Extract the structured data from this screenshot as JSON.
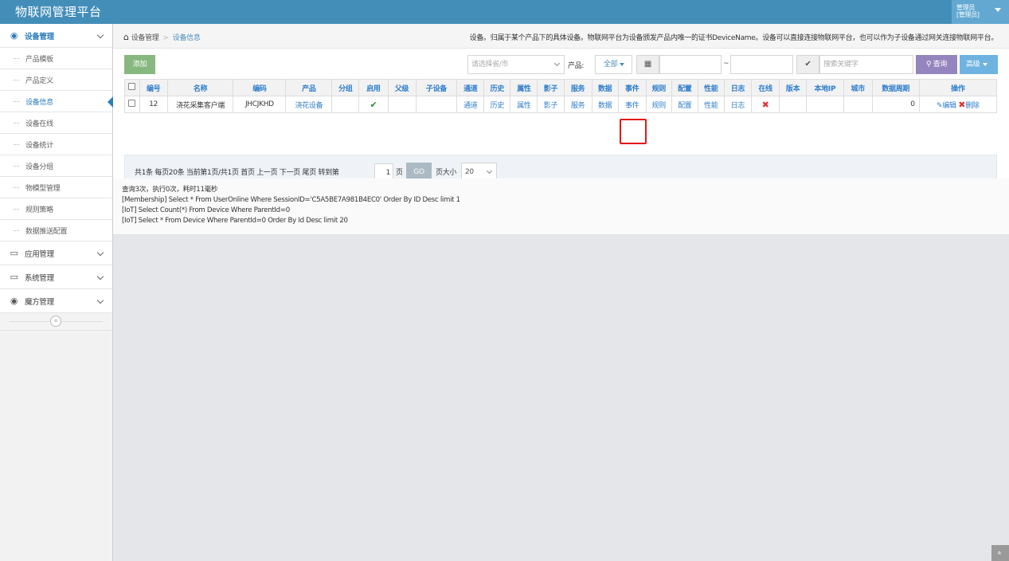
{
  "header": {
    "brand": "物联网管理平台",
    "user_menu": "管理员\n[管理员]"
  },
  "sidebar": {
    "groups": [
      {
        "label": "设备管理",
        "icon": "tachometer-icon",
        "active": true
      },
      {
        "label": "应用管理",
        "icon": "desktop-icon"
      },
      {
        "label": "系统管理",
        "icon": "desktop-icon"
      },
      {
        "label": "魔方管理",
        "icon": "tachometer-icon"
      }
    ],
    "items": [
      {
        "label": "产品模板"
      },
      {
        "label": "产品定义"
      },
      {
        "label": "设备信息",
        "active": true
      },
      {
        "label": "设备在线"
      },
      {
        "label": "设备统计"
      },
      {
        "label": "设备分组"
      },
      {
        "label": "物模型管理"
      },
      {
        "label": "规则策略"
      },
      {
        "label": "数据推送配置"
      }
    ],
    "collapse_label": "«"
  },
  "breadcrumb": {
    "home": "设备管理",
    "separator": ">",
    "current": "设备信息"
  },
  "description": "设备。归属于某个产品下的具体设备。物联网平台为设备颁发产品内唯一的证书DeviceName。设备可以直接连接物联网平台，也可以作为子设备通过网关连接物联网平台。",
  "toolbar": {
    "add": "添加",
    "province_placeholder": "请选择省/市",
    "product_label": "产品:",
    "product_value": "全部",
    "tilde": "~",
    "search_placeholder": "搜索关键字",
    "search": "查询",
    "advanced": "高级"
  },
  "table": {
    "columns": [
      "编号",
      "名称",
      "编码",
      "产品",
      "分组",
      "启用",
      "父级",
      "子设备",
      "通道",
      "历史",
      "属性",
      "影子",
      "服务",
      "数据",
      "事件",
      "规则",
      "配置",
      "性能",
      "日志",
      "在线",
      "版本",
      "本地IP",
      "城市",
      "数据周期",
      "操作"
    ],
    "rows": [
      {
        "id": "12",
        "name": "浇花采集客户端",
        "code": "JHCJKHD",
        "product": "浇花设备",
        "group": "",
        "enabled": true,
        "parent": "",
        "children": "",
        "links": [
          "通道",
          "历史",
          "属性",
          "影子",
          "服务",
          "数据",
          "事件",
          "规则",
          "配置",
          "性能",
          "日志"
        ],
        "online": false,
        "version": "",
        "local_ip": "",
        "city": "",
        "period": "0",
        "edit": "编辑",
        "delete": "删除"
      }
    ]
  },
  "pager": {
    "summary": "共1条 每页20条 当前第1页/共1页 首页 上一页 下一页 尾页 转到第",
    "page": "1",
    "page_unit": "页",
    "go": "GO",
    "page_size_label": "页大小",
    "page_size": "20"
  },
  "logs": [
    "查询3次，执行0次，耗时11毫秒",
    "[Membership] Select * From UserOnline Where SessionID='C5A5BE7A981B4EC0' Order By ID Desc limit 1",
    "[IoT] Select Count(*) From Device Where ParentId=0",
    "[IoT] Select * From Device Where ParentId=0 Order By Id Desc limit 20"
  ],
  "scroll_top": "»"
}
